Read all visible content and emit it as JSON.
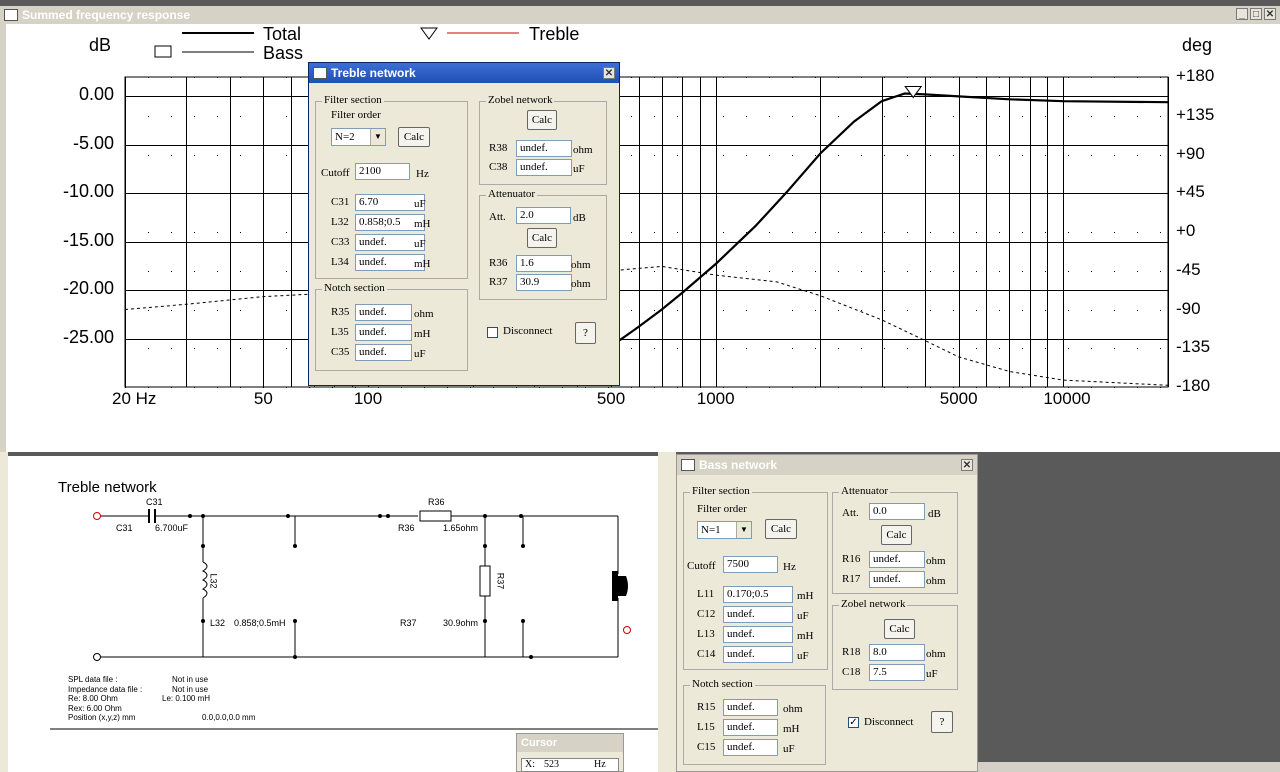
{
  "freq_window": {
    "title": "Summed frequency response",
    "y_left_unit": "dB",
    "y_right_unit": "deg",
    "legend": {
      "total": "Total",
      "bass": "Bass",
      "treble": "Treble"
    },
    "y_left_ticks": [
      "0.00",
      "-5.00",
      "-10.00",
      "-15.00",
      "-20.00",
      "-25.00"
    ],
    "y_right_ticks": [
      "+180",
      "+135",
      "+90",
      "+45",
      "+0",
      "-45",
      "-90",
      "-135",
      "-180"
    ],
    "x_ticks": [
      "20 Hz",
      "50",
      "100",
      "500",
      "1000",
      "5000",
      "10000"
    ]
  },
  "chart_data": {
    "type": "line",
    "title": "",
    "xlabel": "",
    "ylabel": "dB",
    "y2label": "deg",
    "x_scale": "log",
    "xlim": [
      20,
      20000
    ],
    "ylim": [
      -30,
      2
    ],
    "y2lim": [
      -180,
      180
    ],
    "grid": true,
    "series": [
      {
        "name": "Total",
        "axis": "left",
        "style": "solid",
        "x": [
          500,
          600,
          700,
          800,
          1000,
          1300,
          1600,
          2000,
          2500,
          3000,
          3500,
          4000,
          5000,
          7000,
          10000,
          20000
        ],
        "y": [
          -25.8,
          -23.8,
          -22.0,
          -20.3,
          -17.3,
          -13.4,
          -9.9,
          -5.9,
          -2.6,
          -0.5,
          0.3,
          0.2,
          0.0,
          -0.3,
          -0.5,
          -0.6
        ]
      },
      {
        "name": "",
        "axis": "right",
        "style": "dashed",
        "x": [
          20,
          30,
          50,
          70,
          100,
          200,
          300,
          500,
          700,
          1000,
          1500,
          2000,
          3000,
          4000,
          5000,
          7000,
          10000,
          20000
        ],
        "y": [
          -90,
          -84,
          -75,
          -72,
          -70,
          -68,
          -60,
          -45,
          -40,
          -50,
          -58,
          -74,
          -102,
          -126,
          -145,
          -162,
          -172,
          -178
        ]
      }
    ],
    "markers": [
      {
        "name": "Treble",
        "x": 3700,
        "shape": "triangle-down"
      }
    ]
  },
  "treble_dialog": {
    "title": "Treble network",
    "filter_section": "Filter section",
    "filter_order_label": "Filter order",
    "filter_order_value": "N=2",
    "calc": "Calc",
    "cutoff_label": "Cutoff",
    "cutoff_value": "2100",
    "cutoff_unit": "Hz",
    "rows": [
      {
        "label": "C31",
        "value": "6.70",
        "unit": "uF"
      },
      {
        "label": "L32",
        "value": "0.858;0.5",
        "unit": "mH"
      },
      {
        "label": "C33",
        "value": "undef.",
        "unit": "uF"
      },
      {
        "label": "L34",
        "value": "undef.",
        "unit": "mH"
      }
    ],
    "notch_section": "Notch section",
    "notch_rows": [
      {
        "label": "R35",
        "value": "undef.",
        "unit": "ohm"
      },
      {
        "label": "L35",
        "value": "undef.",
        "unit": "mH"
      },
      {
        "label": "C35",
        "value": "undef.",
        "unit": "uF"
      }
    ],
    "zobel_section": "Zobel network",
    "zobel_rows": [
      {
        "label": "R38",
        "value": "undef.",
        "unit": "ohm"
      },
      {
        "label": "C38",
        "value": "undef.",
        "unit": "uF"
      }
    ],
    "atten_section": "Attenuator",
    "att_label": "Att.",
    "att_value": "2.0",
    "att_unit": "dB",
    "atten_rows": [
      {
        "label": "R36",
        "value": "1.6",
        "unit": "ohm"
      },
      {
        "label": "R37",
        "value": "30.9",
        "unit": "ohm"
      }
    ],
    "disconnect": "Disconnect",
    "help": "?"
  },
  "schematic": {
    "title": "Treble network",
    "labels": {
      "c31_top": "C31",
      "c31_left": "C31",
      "c31_val": "6.700uF",
      "r36_top": "R36",
      "r36_left": "R36",
      "r36_val": "1.65ohm",
      "l32": "L32",
      "l32_bottom": "L32",
      "l32_val": "0.858;0.5mH",
      "r37": "R37",
      "r37_bottom": "R37",
      "r37_val": "30.9ohm"
    },
    "info": [
      {
        "k": "SPL data file :",
        "v": "Not in use"
      },
      {
        "k": "Impedance data file :",
        "v": "Not in use"
      },
      {
        "k": "Re:     8.00 Ohm",
        "v": "Le:    0.100 mH"
      },
      {
        "k": "Rex:    6.00 Ohm",
        "v": ""
      },
      {
        "k": "Position (x,y,z) mm",
        "v": "0.0,0.0,0.0 mm"
      }
    ]
  },
  "cursor_window": {
    "title": "Cursor",
    "x_label": "X:",
    "x_value": "523",
    "x_unit": "Hz"
  },
  "bass_dialog": {
    "title": "Bass network",
    "filter_section": "Filter section",
    "filter_order_label": "Filter order",
    "filter_order_value": "N=1",
    "calc": "Calc",
    "cutoff_label": "Cutoff",
    "cutoff_value": "7500",
    "cutoff_unit": "Hz",
    "rows": [
      {
        "label": "L11",
        "value": "0.170;0.5",
        "unit": "mH"
      },
      {
        "label": "C12",
        "value": "undef.",
        "unit": "uF"
      },
      {
        "label": "L13",
        "value": "undef.",
        "unit": "mH"
      },
      {
        "label": "C14",
        "value": "undef.",
        "unit": "uF"
      }
    ],
    "notch_section": "Notch section",
    "notch_rows": [
      {
        "label": "R15",
        "value": "undef.",
        "unit": "ohm"
      },
      {
        "label": "L15",
        "value": "undef.",
        "unit": "mH"
      },
      {
        "label": "C15",
        "value": "undef.",
        "unit": "uF"
      }
    ],
    "atten_section": "Attenuator",
    "att_label": "Att.",
    "att_value": "0.0",
    "att_unit": "dB",
    "atten_rows": [
      {
        "label": "R16",
        "value": "undef.",
        "unit": "ohm"
      },
      {
        "label": "R17",
        "value": "undef.",
        "unit": "ohm"
      }
    ],
    "zobel_section": "Zobel network",
    "zobel_rows": [
      {
        "label": "R18",
        "value": "8.0",
        "unit": "ohm"
      },
      {
        "label": "C18",
        "value": "7.5",
        "unit": "uF"
      }
    ],
    "disconnect": "Disconnect",
    "disconnect_checked": true,
    "help": "?"
  }
}
